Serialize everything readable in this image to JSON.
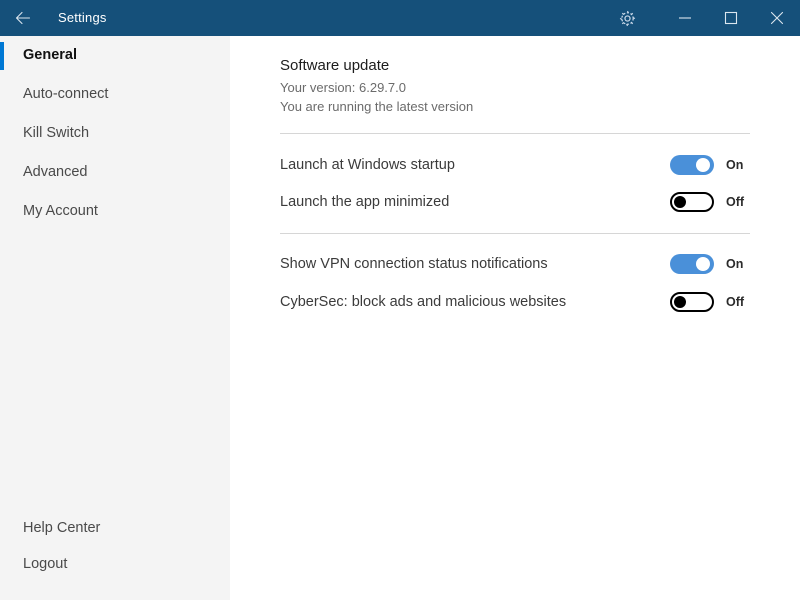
{
  "window": {
    "title": "Settings",
    "titlebar_color": "#15507a",
    "back_icon": "back-arrow-icon",
    "controls": [
      {
        "name": "settings-gear-button",
        "icon": "gear-icon"
      },
      {
        "name": "minimize-button",
        "icon": "minimize-icon"
      },
      {
        "name": "maximize-button",
        "icon": "maximize-icon"
      },
      {
        "name": "close-button",
        "icon": "close-icon"
      }
    ]
  },
  "sidebar": {
    "background": "#f4f4f4",
    "active_indicator_color": "#0078d4",
    "items": [
      {
        "label": "General",
        "active": true
      },
      {
        "label": "Auto-connect",
        "active": false
      },
      {
        "label": "Kill Switch",
        "active": false
      },
      {
        "label": "Advanced",
        "active": false
      },
      {
        "label": "My Account",
        "active": false
      }
    ],
    "footer": [
      {
        "label": "Help Center"
      },
      {
        "label": "Logout"
      }
    ]
  },
  "main": {
    "update": {
      "title": "Software update",
      "version_line": "Your version: 6.29.7.0",
      "status_line": "You are running the latest version"
    },
    "settings": [
      {
        "label": "Launch at Windows startup",
        "state": "On",
        "on": true
      },
      {
        "label": "Launch the app minimized",
        "state": "Off",
        "on": false
      },
      {
        "label": "Show VPN connection status notifications",
        "state": "On",
        "on": true
      },
      {
        "label": "CyberSec: block ads and malicious websites",
        "state": "Off",
        "on": false
      }
    ],
    "toggle_on_color": "#4a90d9",
    "divider_color": "#d6d6d6"
  }
}
